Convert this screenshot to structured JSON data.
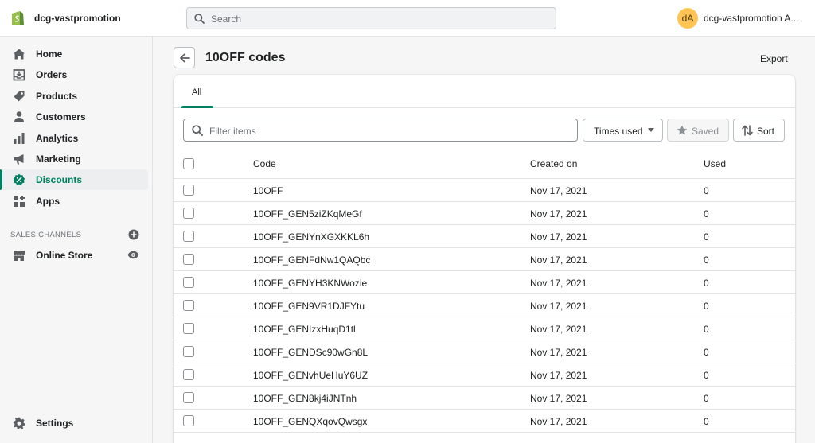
{
  "topbar": {
    "store_name": "dcg-vastpromotion",
    "search_placeholder": "Search",
    "avatar_initials": "dA",
    "account_name": "dcg-vastpromotion A..."
  },
  "sidebar": {
    "items": [
      {
        "label": "Home",
        "icon": "home-icon"
      },
      {
        "label": "Orders",
        "icon": "orders-icon"
      },
      {
        "label": "Products",
        "icon": "tag-icon"
      },
      {
        "label": "Customers",
        "icon": "person-icon"
      },
      {
        "label": "Analytics",
        "icon": "bar-chart-icon"
      },
      {
        "label": "Marketing",
        "icon": "megaphone-icon"
      },
      {
        "label": "Discounts",
        "icon": "discount-icon",
        "active": true
      },
      {
        "label": "Apps",
        "icon": "apps-icon"
      }
    ],
    "sales_channels_label": "SALES CHANNELS",
    "online_store_label": "Online Store",
    "settings_label": "Settings"
  },
  "page": {
    "title": "10OFF codes",
    "export_label": "Export"
  },
  "tabs": [
    {
      "label": "All",
      "selected": true
    }
  ],
  "toolbar": {
    "filter_placeholder": "Filter items",
    "times_used_label": "Times used",
    "saved_label": "Saved",
    "sort_label": "Sort"
  },
  "table": {
    "headers": {
      "code": "Code",
      "created": "Created on",
      "used": "Used"
    },
    "rows": [
      {
        "code": "10OFF",
        "created": "Nov 17, 2021",
        "used": "0"
      },
      {
        "code": "10OFF_GEN5ziZKqMeGf",
        "created": "Nov 17, 2021",
        "used": "0"
      },
      {
        "code": "10OFF_GENYnXGXKKL6h",
        "created": "Nov 17, 2021",
        "used": "0"
      },
      {
        "code": "10OFF_GENFdNw1QAQbc",
        "created": "Nov 17, 2021",
        "used": "0"
      },
      {
        "code": "10OFF_GENYH3KNWozie",
        "created": "Nov 17, 2021",
        "used": "0"
      },
      {
        "code": "10OFF_GEN9VR1DJFYtu",
        "created": "Nov 17, 2021",
        "used": "0"
      },
      {
        "code": "10OFF_GENIzxHuqD1tl",
        "created": "Nov 17, 2021",
        "used": "0"
      },
      {
        "code": "10OFF_GENDSc90wGn8L",
        "created": "Nov 17, 2021",
        "used": "0"
      },
      {
        "code": "10OFF_GENvhUeHuY6UZ",
        "created": "Nov 17, 2021",
        "used": "0"
      },
      {
        "code": "10OFF_GEN8kj4iJNTnh",
        "created": "Nov 17, 2021",
        "used": "0"
      },
      {
        "code": "10OFF_GENQXqovQwsgx",
        "created": "Nov 17, 2021",
        "used": "0"
      }
    ]
  },
  "colors": {
    "accent": "#008060",
    "avatar_bg": "#ffc453"
  }
}
